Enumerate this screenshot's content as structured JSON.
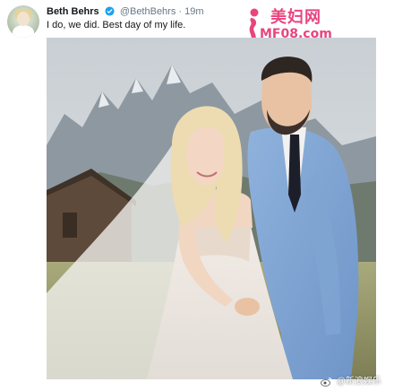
{
  "tweet": {
    "display_name": "Beth Behrs",
    "handle": "@BethBehrs",
    "separator": "·",
    "time": "19m",
    "text": "I do, we did. Best day of my life.",
    "verified_icon": "verified-badge-icon",
    "verified_color": "#1da1f2"
  },
  "watermark": {
    "title": "美妇网",
    "url": "MF08.com",
    "color": "#e8457f"
  },
  "weibo_watermark": {
    "text": "@新浪娱乐",
    "icon": "weibo-icon"
  }
}
